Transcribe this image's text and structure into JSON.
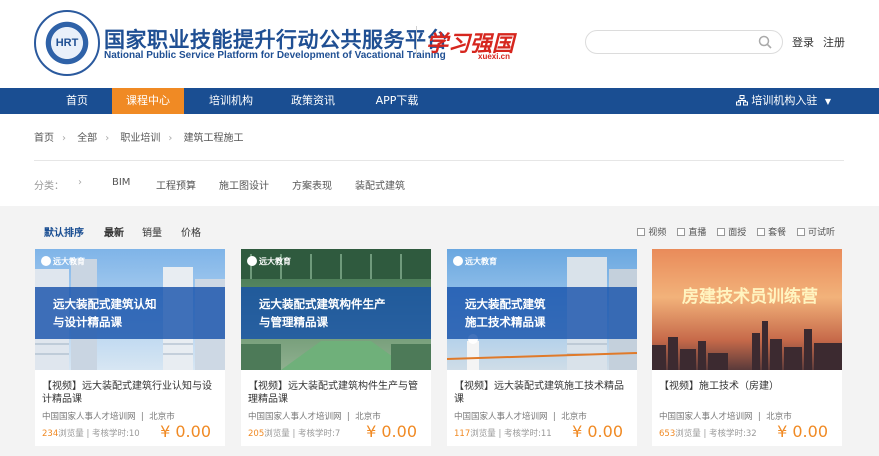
{
  "header": {
    "logo_text": "HRT",
    "title": "国家职业技能提升行动公共服务平台",
    "subtitle": "National Public Service Platform for Development of Vacational Training",
    "partner_logo": "学习强国",
    "partner_url": "xuexi.cn",
    "search_placeholder": "",
    "login": "登录",
    "register": "注册"
  },
  "nav": {
    "items": [
      "首页",
      "课程中心",
      "培训机构",
      "政策资讯",
      "APP下载"
    ],
    "active_index": 1,
    "right_label": "培训机构入驻"
  },
  "breadcrumb": [
    "首页",
    "全部",
    "职业培训",
    "建筑工程施工"
  ],
  "categories": {
    "label": "分类：",
    "items": [
      "BIM",
      "工程预算",
      "施工图设计",
      "方案表现",
      "装配式建筑"
    ]
  },
  "sort": {
    "items": [
      "默认排序",
      "最新",
      "销量",
      "价格"
    ]
  },
  "filters": [
    "视频",
    "直播",
    "面授",
    "套餐",
    "可试听"
  ],
  "courses": [
    {
      "thumb_brand": "远大教育",
      "thumb_line1": "远大装配式建筑认知",
      "thumb_line2": "与设计精品课",
      "title": "【视频】远大装配式建筑行业认知与设计精品课",
      "provider": "中国国家人事人才培训网",
      "city": "北京市",
      "views": "234",
      "views_suffix": "浏览量",
      "hours": "考核学时:10",
      "price": "¥ 0.00"
    },
    {
      "thumb_brand": "远大教育",
      "thumb_line1": "远大装配式建筑构件生产",
      "thumb_line2": "与管理精品课",
      "title": "【视频】远大装配式建筑构件生产与管理精品课",
      "provider": "中国国家人事人才培训网",
      "city": "北京市",
      "views": "205",
      "views_suffix": "浏览量",
      "hours": "考核学时:7",
      "price": "¥ 0.00"
    },
    {
      "thumb_brand": "远大教育",
      "thumb_line1": "远大装配式建筑",
      "thumb_line2": "施工技术精品课",
      "title": "【视频】远大装配式建筑施工技术精品课",
      "provider": "中国国家人事人才培训网",
      "city": "北京市",
      "views": "117",
      "views_suffix": "浏览量",
      "hours": "考核学时:11",
      "price": "¥ 0.00"
    },
    {
      "thumb_line1": "房建技术员训练营",
      "title": "【视频】施工技术（房建）",
      "provider": "中国国家人事人才培训网",
      "city": "北京市",
      "views": "653",
      "views_suffix": "浏览量",
      "hours": "考核学时:32",
      "price": "¥ 0.00"
    }
  ],
  "colors": {
    "primary": "#1a4e92",
    "accent": "#f08a24",
    "xuexi_red": "#d6261e"
  }
}
